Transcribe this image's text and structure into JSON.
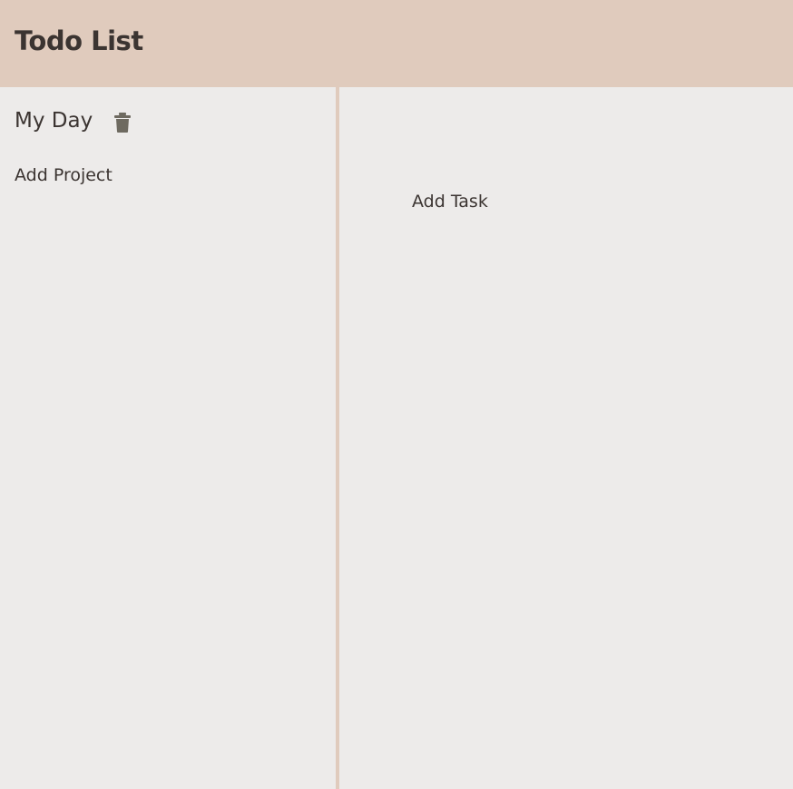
{
  "header": {
    "title": "Todo List"
  },
  "sidebar": {
    "projects": [
      {
        "name": "My Day",
        "delete_icon": "trash-icon"
      }
    ],
    "add_project_label": "Add Project"
  },
  "main": {
    "add_task_label": "Add Task"
  },
  "colors": {
    "header_bg": "#e0cbbd",
    "panel_bg": "#edebea",
    "text": "#3b3431",
    "icon": "#6e6a60"
  }
}
